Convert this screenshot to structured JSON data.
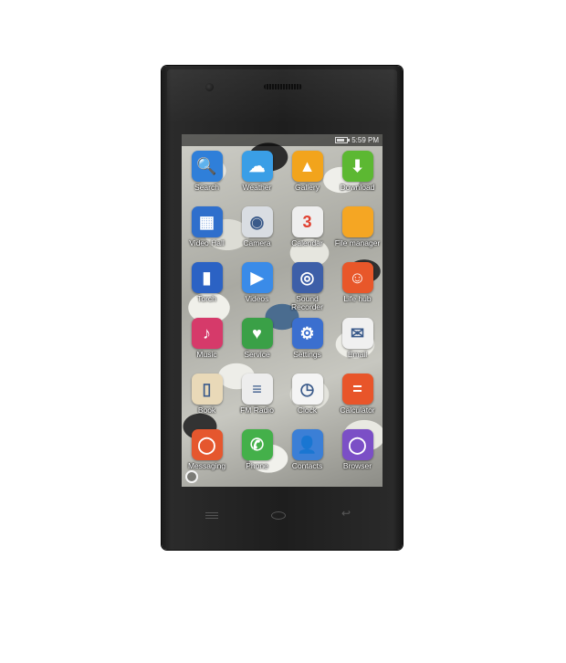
{
  "status_bar": {
    "time": "5:59 PM"
  },
  "apps": [
    {
      "label": "Search",
      "icon": "search-icon",
      "color": "#2f7fd9",
      "glyph": "🔍"
    },
    {
      "label": "Weather",
      "icon": "weather-icon",
      "color": "#3a9ee6",
      "glyph": "☁"
    },
    {
      "label": "Gallery",
      "icon": "gallery-icon",
      "color": "#f2a41c",
      "glyph": "▲"
    },
    {
      "label": "Download",
      "icon": "download-icon",
      "color": "#5cb832",
      "glyph": "⬇"
    },
    {
      "label": "Video Hall",
      "icon": "video-icon",
      "color": "#2f6fcc",
      "glyph": "▦"
    },
    {
      "label": "Camera",
      "icon": "camera-icon",
      "color": "#d9dde2",
      "glyph": "◉"
    },
    {
      "label": "Calendar",
      "icon": "calendar-icon",
      "color": "#eeeeee",
      "glyph": "3"
    },
    {
      "label": "File manager",
      "icon": "folder-icon",
      "color": "#f5a623",
      "glyph": ""
    },
    {
      "label": "Torch",
      "icon": "torch-icon",
      "color": "#2b62c4",
      "glyph": "▮"
    },
    {
      "label": "Videos",
      "icon": "play-icon",
      "color": "#3a8be8",
      "glyph": "▶"
    },
    {
      "label": "Sound Recorder",
      "icon": "recorder-icon",
      "color": "#3d5fa8",
      "glyph": "◎"
    },
    {
      "label": "Life hub",
      "icon": "life-hub-icon",
      "color": "#e8572a",
      "glyph": "☺"
    },
    {
      "label": "Music",
      "icon": "music-icon",
      "color": "#d63a6a",
      "glyph": "♪"
    },
    {
      "label": "Service",
      "icon": "service-icon",
      "color": "#3aa047",
      "glyph": "♥"
    },
    {
      "label": "Settings",
      "icon": "settings-icon",
      "color": "#3b6fcf",
      "glyph": "⚙"
    },
    {
      "label": "Email",
      "icon": "email-icon",
      "color": "#f0f0f0",
      "glyph": "✉"
    },
    {
      "label": "Book",
      "icon": "book-icon",
      "color": "#e9d9b8",
      "glyph": "▯"
    },
    {
      "label": "FM Radio",
      "icon": "radio-icon",
      "color": "#ededed",
      "glyph": "≡"
    },
    {
      "label": "Clock",
      "icon": "clock-icon",
      "color": "#f4f4f4",
      "glyph": "◷"
    },
    {
      "label": "Calculator",
      "icon": "calculator-icon",
      "color": "#e8552a",
      "glyph": "="
    },
    {
      "label": "Messaging",
      "icon": "messaging-icon",
      "color": "#e5572e",
      "glyph": "◯"
    },
    {
      "label": "Phone",
      "icon": "phone-icon",
      "color": "#44b04a",
      "glyph": "✆"
    },
    {
      "label": "Contacts",
      "icon": "contacts-icon",
      "color": "#3b7fd6",
      "glyph": "👤"
    },
    {
      "label": "Browser",
      "icon": "browser-icon",
      "color": "#7b4fc6",
      "glyph": "◯"
    }
  ]
}
